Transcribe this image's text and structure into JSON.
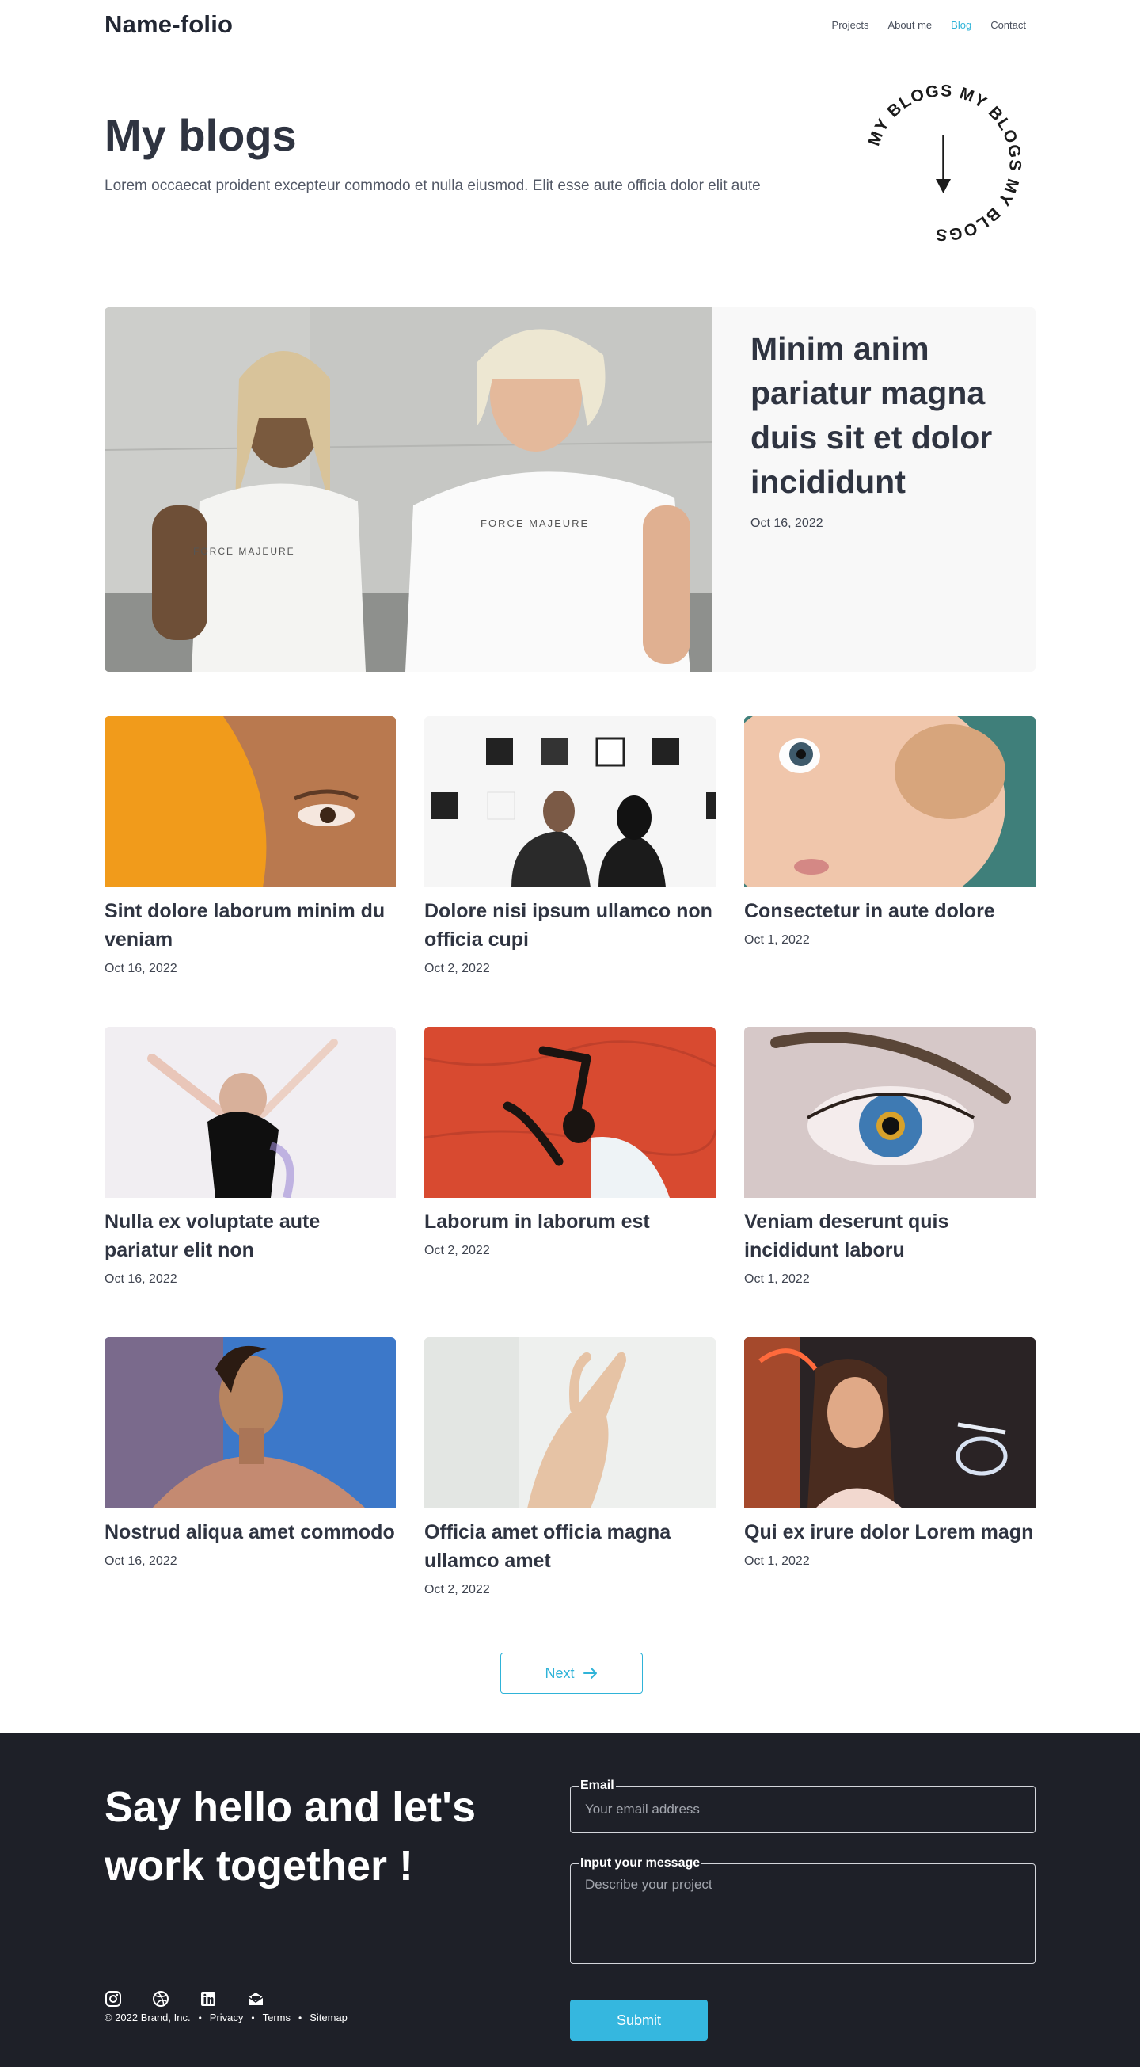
{
  "header": {
    "brand": "Name-folio",
    "nav": [
      {
        "label": "Projects"
      },
      {
        "label": "About me"
      },
      {
        "label": "Blog",
        "active": true
      },
      {
        "label": "Contact"
      }
    ]
  },
  "hero": {
    "title": "My blogs",
    "description": "Lorem occaecat proident excepteur commodo et nulla eiusmod. Elit esse aute officia dolor elit aute",
    "badge_text": "MY BLOGS MY BLOGS MY BLOGS"
  },
  "featured": {
    "title": "Minim anim pariatur magna duis sit et dolor incididunt",
    "date": "Oct 16, 2022",
    "image_shirt_text": "FORCE MAJEURE"
  },
  "posts": [
    {
      "title": "Sint dolore laborum minim du veniam",
      "date": "Oct 16, 2022"
    },
    {
      "title": "Dolore nisi ipsum ullamco non officia cupi",
      "date": "Oct 2, 2022"
    },
    {
      "title": "Consectetur in aute dolore",
      "date": "Oct 1, 2022"
    },
    {
      "title": "Nulla ex voluptate aute pariatur elit non",
      "date": "Oct 16, 2022"
    },
    {
      "title": "Laborum in laborum est",
      "date": "Oct 2, 2022"
    },
    {
      "title": "Veniam deserunt quis incididunt laboru",
      "date": "Oct 1, 2022"
    },
    {
      "title": "Nostrud aliqua amet commodo",
      "date": "Oct 16, 2022"
    },
    {
      "title": "Officia amet officia magna ullamco amet",
      "date": "Oct 2, 2022"
    },
    {
      "title": "Qui ex irure dolor Lorem magn",
      "date": "Oct 1, 2022"
    }
  ],
  "pagination": {
    "next_label": "Next"
  },
  "footer": {
    "heading": "Say hello and let's work together !",
    "socials": [
      "instagram-icon",
      "dribbble-icon",
      "linkedin-icon",
      "mail-open-icon"
    ],
    "copyright": "© 2022 Brand, Inc.",
    "links": [
      "Privacy",
      "Terms",
      "Sitemap"
    ],
    "form": {
      "email_label": "Email",
      "email_placeholder": "Your email address",
      "message_label": "Input your message",
      "message_placeholder": "Describe your project",
      "submit_label": "Submit"
    }
  },
  "colors": {
    "accent": "#2fb3d8",
    "text": "#2f3441",
    "footer_bg": "#1e2028",
    "card_bg": "#f8f8f8"
  }
}
